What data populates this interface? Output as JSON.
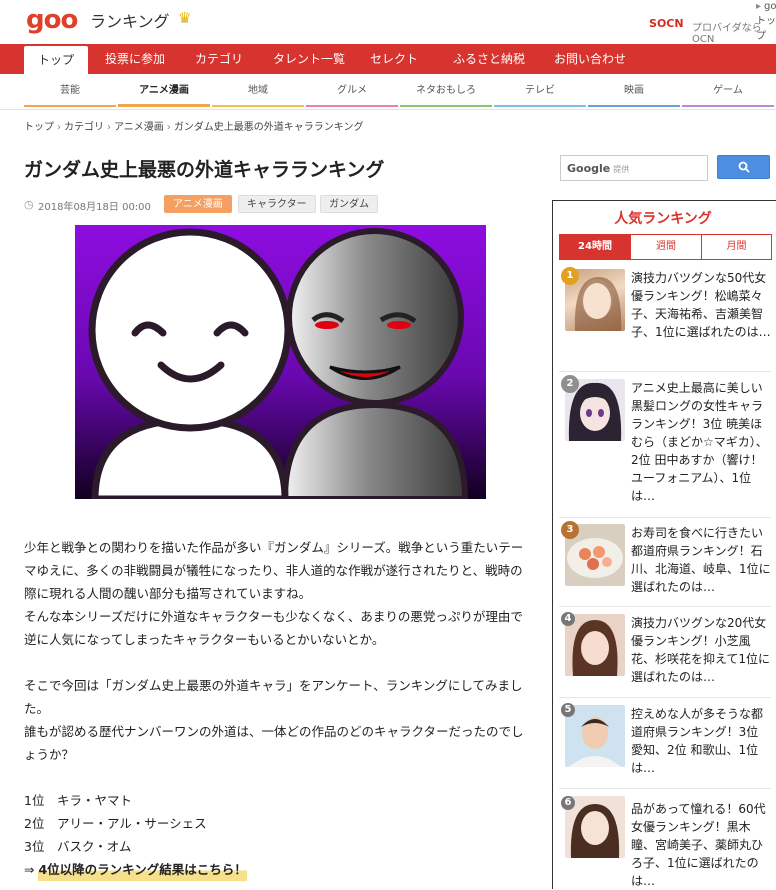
{
  "header": {
    "logo": "goo",
    "site_name": "ランキング",
    "crown_icon": "crown-icon",
    "goo_top_link": "gooトップ",
    "ocn_logo": "OCN",
    "ocn_text": "プロバイダならOCN"
  },
  "nav": {
    "items": [
      "トップ",
      "投票に参加",
      "カテゴリ",
      "タレント一覧",
      "セレクト",
      "ふるさと納税",
      "お問い合わせ"
    ],
    "active": "トップ"
  },
  "subnav": {
    "items": [
      "芸能",
      "アニメ漫画",
      "地域",
      "グルメ",
      "ネタおもしろ",
      "テレビ",
      "映画",
      "ゲーム"
    ],
    "active": "アニメ漫画",
    "colors": [
      "#f0a74a",
      "#f0a74a",
      "#e9c64a",
      "#ef7fa8",
      "#8ac56b",
      "#7fc1e0",
      "#6a9fd8",
      "#b98ad8"
    ]
  },
  "breadcrumb": [
    "トップ",
    "カテゴリ",
    "アニメ漫画",
    "ガンダム史上最悪の外道キャラランキング"
  ],
  "article": {
    "title": "ガンダム史上最悪の外道キャラランキング",
    "date": "2018年08月18日 00:00",
    "tags": [
      "アニメ漫画",
      "キャラクター",
      "ガンダム"
    ],
    "paragraphs": [
      "少年と戦争との関わりを描いた作品が多い『ガンダム』シリーズ。戦争という重たいテーマゆえに、多くの非戦闘員が犠牲になったり、非人道的な作戦が遂行されたりと、戦時の際に現れる人間の醜い部分も描写されていますね。",
      "そんな本シリーズだけに外道なキャラクターも少なくなく、あまりの悪党っぷりが理由で逆に人気になってしまったキャラクターもいるとかいないとか。",
      "",
      "そこで今回は「ガンダム史上最悪の外道キャラ」をアンケート、ランキングにしてみました。",
      "誰もが認める歴代ナンバーワンの外道は、一体どの作品のどのキャラクターだったのでしょうか？",
      ""
    ],
    "ranking": [
      "1位　キラ・ヤマト",
      "2位　アリー・アル・サーシェス",
      "3位　バスク・オム"
    ],
    "more_prefix": "⇒ ",
    "more_link": "4位以降のランキング結果はこちら！"
  },
  "search": {
    "brand": "Google",
    "suffix": "提供",
    "button_icon": "search-icon"
  },
  "sidebar": {
    "title": "人気ランキング",
    "tabs": [
      "24時間",
      "週間",
      "月間"
    ],
    "active_tab": "24時間",
    "items": [
      {
        "rank": "1",
        "text": "演技力バツグンな50代女優ランキング！松嶋菜々子、天海祐希、吉瀬美智子、1位に選ばれたのは…",
        "badge": "#e0a020"
      },
      {
        "rank": "2",
        "text": "アニメ史上最高に美しい黒髪ロングの女性キャラランキング！3位 暁美ほむら（まどか☆マギカ）、2位 田中あすか（響け！ユーフォニアム）、1位は…",
        "badge": "#8f8f8f"
      },
      {
        "rank": "3",
        "text": "お寿司を食べに行きたい都道府県ランキング！石川、北海道、岐阜、1位に選ばれたのは…",
        "badge": "#b87332"
      },
      {
        "rank": "4",
        "text": "演技力バツグンな20代女優ランキング！小芝風花、杉咲花を抑えて1位に選ばれたのは…",
        "badge": "#777777"
      },
      {
        "rank": "5",
        "text": "控えめな人が多そうな都道府県ランキング！3位 愛知、2位 和歌山、1位は…",
        "badge": "#777777"
      },
      {
        "rank": "6",
        "text": "品があって憧れる！60代女優ランキング！黒木瞳、宮崎美子、薬師丸ひろ子、1位に選ばれたのは…",
        "badge": "#777777"
      }
    ]
  },
  "colors": {
    "brand_red": "#d8342f",
    "tag_orange": "#f4a062",
    "search_blue": "#4d8ee1"
  }
}
